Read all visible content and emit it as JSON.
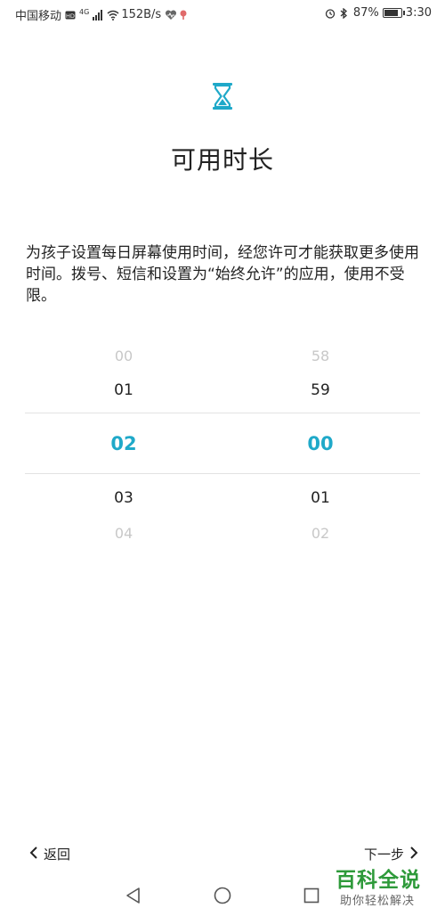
{
  "status_bar": {
    "carrier": "中国移动",
    "signal_badge": "4G",
    "net_speed": "152B/s",
    "battery": "87%",
    "battery_level": 0.87,
    "time": "3:30"
  },
  "header": {
    "icon": "hourglass-icon",
    "title": "可用时长"
  },
  "description": "为孩子设置每日屏幕使用时间，经您许可才能获取更多使用时间。拨号、短信和设置为“始终允许”的应用，使用不受限。",
  "picker": {
    "hours": [
      "00",
      "01",
      "02",
      "03",
      "04"
    ],
    "minutes": [
      "58",
      "59",
      "00",
      "01",
      "02"
    ],
    "selected_hour": "02",
    "selected_minute": "00"
  },
  "nav": {
    "back_label": "返回",
    "next_label": "下一步"
  },
  "colors": {
    "accent": "#1fa9c9",
    "watermark": "#2e9a3a"
  },
  "watermark": {
    "main": "百科全说",
    "sub": "助你轻松解决"
  }
}
